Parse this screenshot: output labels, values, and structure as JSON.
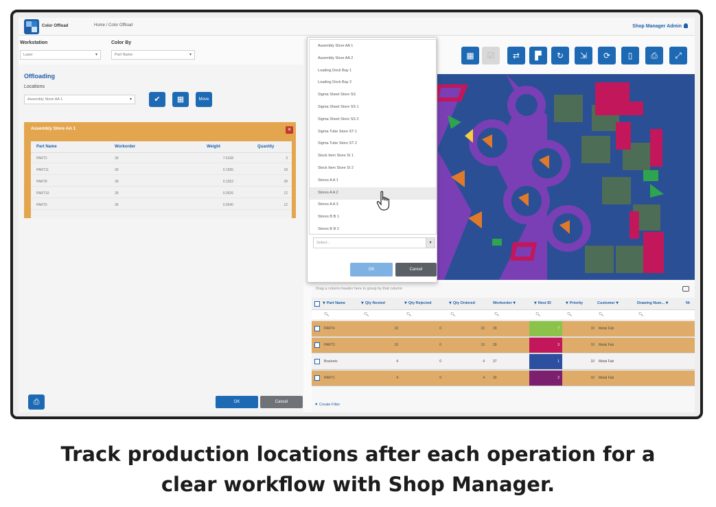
{
  "app": {
    "name": "Color Offload",
    "breadcrumb": "Home / Color Offload",
    "user": "Shop Manager Admin"
  },
  "workstation": {
    "label": "Workstation",
    "value": "Laser"
  },
  "color_by": {
    "label": "Color By",
    "value": "Part Name"
  },
  "toolbar_icons": [
    "pallet-icon",
    "checkbox-icon",
    "swap-icon",
    "layout-icon",
    "refresh-icon",
    "export-icon",
    "rotate-icon",
    "document-icon",
    "print-icon",
    "expand-icon"
  ],
  "offloading": {
    "title": "Offloading",
    "locations_label": "Locations",
    "location_value": "Assembly Store AA 1",
    "move_label": "Move",
    "store_panel": {
      "title": "Assembly Store AA 1",
      "columns": [
        "Part Name",
        "Workorder",
        "Weight",
        "Quantity"
      ],
      "rows": [
        [
          "PART2",
          "39",
          "7.6168",
          "3"
        ],
        [
          "PART11",
          "39",
          "0.1585",
          "18"
        ],
        [
          "PART8",
          "39",
          "0.1352",
          "28"
        ],
        [
          "PART10",
          "39",
          "0.0526",
          "12"
        ],
        [
          "PART5",
          "36",
          "0.0040",
          "12"
        ]
      ]
    },
    "ok_label": "OK",
    "cancel_label": "Cancel"
  },
  "grid": {
    "group_hint": "Drag a column header here to group by that column",
    "columns": [
      "Part Name",
      "Qty Nested",
      "Qty Rejected",
      "Qty Ordered",
      "Workorder",
      "Nest ID",
      "Priority",
      "Customer",
      "Drawing Num...",
      "Nt"
    ],
    "rows": [
      {
        "part": "PART4",
        "nested": "10",
        "rejected": "0",
        "ordered": "10",
        "workorder": "39",
        "nest_id": "7",
        "priority": "10",
        "customer": "Metal Fab",
        "nest_color": "#8bc34a",
        "highlight": true
      },
      {
        "part": "PART3",
        "nested": "10",
        "rejected": "0",
        "ordered": "10",
        "workorder": "39",
        "nest_id": "3",
        "priority": "10",
        "customer": "Metal Fab",
        "nest_color": "#c2185b",
        "highlight": true
      },
      {
        "part": "Brackets",
        "nested": "4",
        "rejected": "0",
        "ordered": "4",
        "workorder": "37",
        "nest_id": "1",
        "priority": "10",
        "customer": "Metal Fab",
        "nest_color": "#2d4fa0",
        "highlight": false
      },
      {
        "part": "PART1",
        "nested": "4",
        "rejected": "0",
        "ordered": "4",
        "workorder": "39",
        "nest_id": "2",
        "priority": "10",
        "customer": "Metal Fab",
        "nest_color": "#7b1f6e",
        "highlight": true
      }
    ],
    "create_filter": "Create Filter"
  },
  "dialog": {
    "items": [
      "Assembly Store AA 1",
      "Assembly Store AA 2",
      "Loading Dock Bay 1",
      "Loading Dock Bay 2",
      "Sigma Sheet Store SS",
      "Sigma Sheet Store SS 1",
      "Sigma Sheet Store SS 2",
      "Sigma Tube Store ST 1",
      "Sigma Tube Store ST 2",
      "Stock Item Store SI 1",
      "Stock Item Store SI 2",
      "Stores A A 1",
      "Stores A A 2",
      "Stores A A 3",
      "Stores B B 1",
      "Stores B B 2"
    ],
    "hovered_index": 12,
    "select_placeholder": "Select...",
    "ok_label": "OK",
    "cancel_label": "Cancel"
  },
  "caption": {
    "line1": "Track production locations after each operation for a",
    "line2": "clear workflow with Shop Manager."
  },
  "colors": {
    "accent": "#1d69b4",
    "row_highlight": "#deab68",
    "panel_orange": "#e3a64f",
    "nest_bg": "#2a4f94",
    "nest_purple": "#7a3fb5"
  }
}
